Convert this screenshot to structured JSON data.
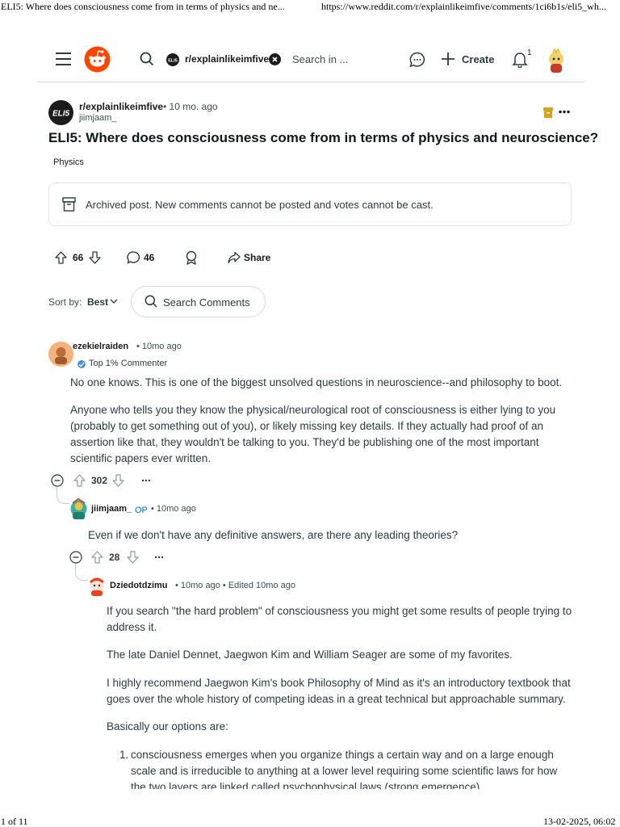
{
  "print": {
    "title": "ELI5: Where does consciousness come from in terms of physics and ne...",
    "url": "https://www.reddit.com/r/explainlikeimfive/comments/1ci6b1s/eli5_wh...",
    "page": "1 of 11",
    "datetime": "13-02-2025, 06:02"
  },
  "header": {
    "subreddit_chip": "r/explainlikeimfive",
    "search_placeholder": "Search in ...",
    "create_label": "Create",
    "notification_count": "1"
  },
  "post": {
    "community_logo": "ELI5",
    "subreddit": "r/explainlikeimfive",
    "age": "• 10 mo. ago",
    "author": "jiimjaam_",
    "title": "ELI5: Where does consciousness come from in terms of physics and neuroscience?",
    "flair": "Physics",
    "archived_notice": "Archived post. New comments cannot be posted and votes cannot be cast.",
    "votes": "66",
    "comments": "46",
    "share_label": "Share"
  },
  "sort": {
    "label": "Sort by:",
    "value": "Best",
    "search_comments": "Search Comments"
  },
  "comments": [
    {
      "author": "ezekielraiden",
      "meta": "• 10mo ago",
      "badge": "Top 1% Commenter",
      "paragraphs": [
        "No one knows. This is one of the biggest unsolved questions in neuroscience--and philosophy to boot.",
        "Anyone who tells you they know the physical/neurological root of consciousness is either lying to you (probably to get something out of you), or likely missing key details. If they actually had proof of an assertion like that, they wouldn't be talking to you. They'd be publishing one of the most important scientific papers ever written."
      ],
      "votes": "302"
    },
    {
      "author": "jiimjaam_",
      "op": "OP",
      "meta": "• 10mo ago",
      "paragraphs": [
        "Even if we don't have any definitive answers, are there any leading theories?"
      ],
      "votes": "28"
    },
    {
      "author": "Dziedotdzimu",
      "meta": "• 10mo ago • Edited 10mo ago",
      "paragraphs": [
        "If you search \"the hard problem\" of consciousness you might get some results of people trying to address it.",
        "The late Daniel Dennet, Jaegwon Kim and William Seager are some of my favorites.",
        "I highly recommend Jaegwon Kim's book Philosophy of Mind as it's an introductory textbook that goes over the whole history of competing ideas in a great technical but approachable summary.",
        "Basically our options are:"
      ],
      "list": [
        {
          "num": "1.",
          "text": "consciousness emerges when you organize things a certain way and on a large enough scale and is irreducible to anything at a lower level requiring some scientific laws for how the two layers are linked called psychophysical laws (strong emergence)."
        }
      ]
    }
  ],
  "colors": {
    "reddit_orange": "#ff4500",
    "text": "#1a1a1b",
    "muted": "#576f76",
    "op_blue": "#0a66d1",
    "border": "#d6dadc",
    "archive_icon": "#d6a31c"
  }
}
